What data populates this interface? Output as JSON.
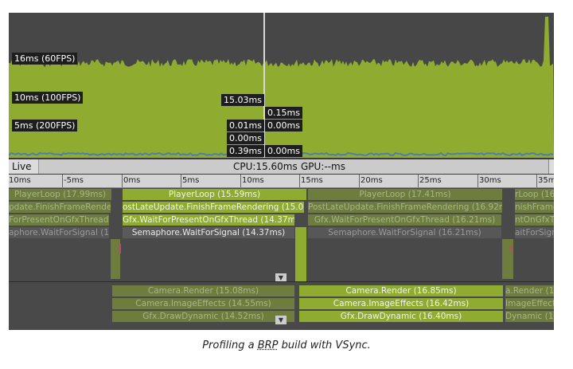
{
  "chart": {
    "fps_labels": {
      "l16": "16ms (60FPS)",
      "l10": "10ms (100FPS)",
      "l5": "5ms (200FPS)"
    },
    "values": {
      "a": "15.03ms",
      "b": "0.15ms",
      "c": "0.01ms",
      "d": "0.00ms",
      "e": "0.00ms",
      "f": "0.39ms",
      "g": "0.00ms"
    },
    "fill_color": "#8fac30"
  },
  "status": {
    "live": "Live",
    "cpu": "CPU:15.60ms",
    "gpu": "GPU:--ms"
  },
  "ruler": {
    "ticks": [
      "10ms",
      "-5ms",
      "0ms",
      "5ms",
      "10ms",
      "15ms",
      "20ms",
      "25ms",
      "30ms",
      "35m"
    ]
  },
  "timeline": {
    "prev": {
      "playerloop": "PlayerLoop (17.99ms)",
      "finish": "pdate.FinishFrameRendering",
      "waitpresent": "ForPresentOnGfxThread (",
      "semaphore": "aphore.WaitForSignal (16.7"
    },
    "current": {
      "playerloop": "PlayerLoop (15.59ms)",
      "finish": "ostLateUpdate.FinishFrameRendering (15.08ms",
      "waitpresent": "Gfx.WaitForPresentOnGfxThread (14.37ms)",
      "semaphore": "Semaphore.WaitForSignal (14.37ms)",
      "camera_render": "Camera.Render (15.08ms)",
      "image_effects": "Camera.ImageEffects (14.55ms)",
      "draw_dynamic": "Gfx.DrawDynamic (14.52ms)"
    },
    "next": {
      "playerloop": "PlayerLoop (17.41ms)",
      "finish": "PostLateUpdate.FinishFrameRendering (16.92ms)",
      "waitpresent": "Gfx.WaitForPresentOnGfxThread (16.21ms)",
      "semaphore": "Semaphore.WaitForSignal (16.21ms)",
      "camera_render": "Camera.Render (16.85ms)",
      "image_effects": "Camera.ImageEffects (16.42ms)",
      "draw_dynamic": "Gfx.DrawDynamic (16.40ms)"
    },
    "after": {
      "playerloop": "rLoop (16.",
      "finish": "nishFrameRe",
      "waitpresent": "ntOnGfxTh",
      "semaphore": "aitForSign",
      "camera_render": "a.Render (16",
      "image_effects": "ImageEffect",
      "draw_dynamic": "Dynamic (1"
    }
  },
  "caption": {
    "before": "Profiling a ",
    "acronym": "BRP",
    "after": " build with VSync."
  }
}
